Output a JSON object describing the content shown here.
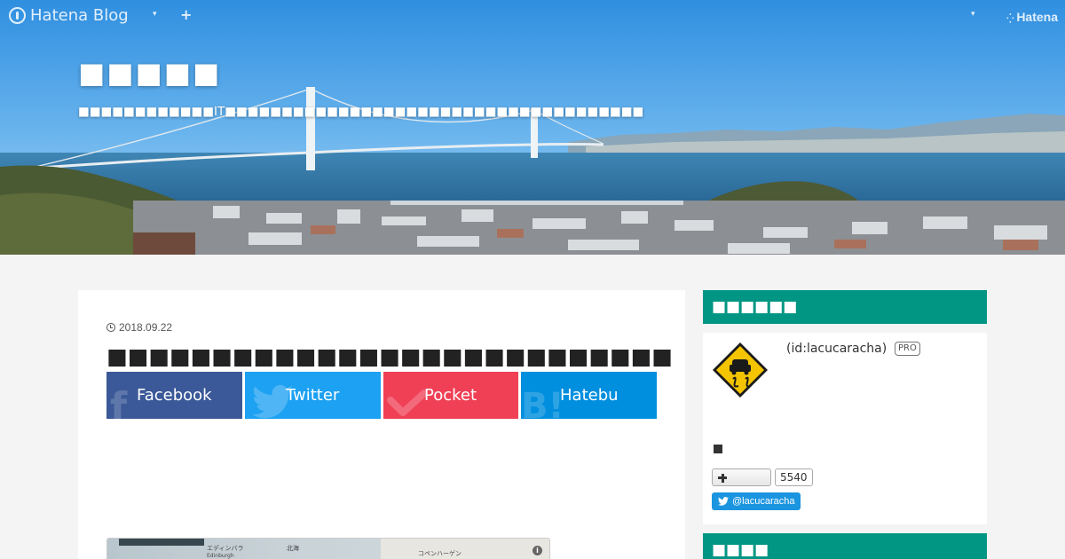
{
  "topbar": {
    "brand": "Hatena Blog",
    "add_symbol": "+",
    "caret_symbol": "▾",
    "hatena_label": "Hatena",
    "hatena_dots": "⁛"
  },
  "blog": {
    "title": "■■■■■",
    "description": "■■■■■■■■■■■■IT■■■■■■■■■■■■■■■■■■■■■■■■■■■■■■■■■■■■■"
  },
  "article": {
    "date": "2018.09.22",
    "title": "■■■■■■■■■■■■■■■■■■■■■■■■■■■■■■■■■",
    "share": {
      "facebook": "Facebook",
      "twitter": "Twitter",
      "pocket": "Pocket",
      "hatebu": "Hatebu"
    },
    "map": {
      "label_edinburgh_ja": "エディンバラ",
      "label_edinburgh": "Edinburgh",
      "label_north_sea": "北海",
      "label_copenhagen": "コペンハーゲン",
      "info": "i"
    }
  },
  "sidebar": {
    "profile_heading": "■■■■■■",
    "profile_id": "(id:lacucaracha)",
    "pro_badge": "PRO",
    "bookmark_count": "5540",
    "twitter_follow": "@lacucaracha",
    "second_heading": "■■■■"
  },
  "colors": {
    "accent": "#009683",
    "facebook": "#3b5998",
    "twitter": "#1da1f2",
    "pocket": "#ef4056",
    "hatebu": "#008fde"
  }
}
